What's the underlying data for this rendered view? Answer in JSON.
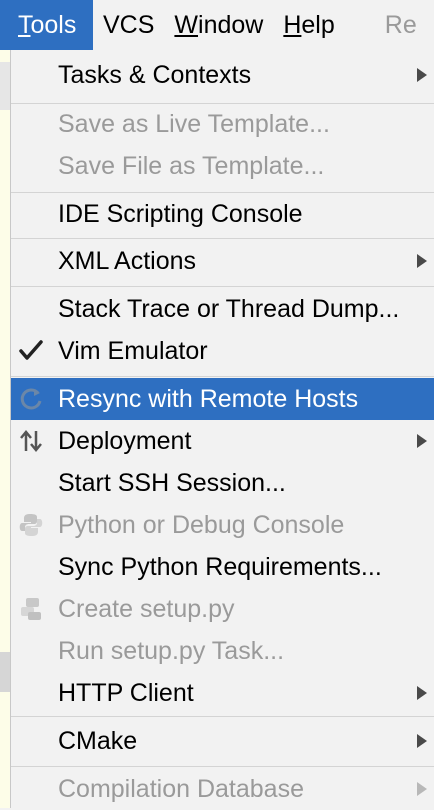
{
  "menubar": {
    "items": [
      {
        "label": "Tools",
        "active": true
      },
      {
        "label": "VCS"
      },
      {
        "label": "Window"
      },
      {
        "label": "Help"
      },
      {
        "label": "Re"
      }
    ]
  },
  "menu": {
    "tasks": "Tasks & Contexts",
    "save_live_template": "Save as Live Template...",
    "save_file_template": "Save File as Template...",
    "ide_scripting": "IDE Scripting Console",
    "xml_actions": "XML Actions",
    "stack_trace": "Stack Trace or Thread Dump...",
    "vim_emulator": "Vim Emulator",
    "resync": "Resync with Remote Hosts",
    "deployment": "Deployment",
    "ssh": "Start SSH Session...",
    "python_console": "Python or Debug Console",
    "sync_python": "Sync Python Requirements...",
    "create_setup": "Create setup.py",
    "run_setup": "Run setup.py Task...",
    "http_client": "HTTP Client",
    "cmake": "CMake",
    "compilation_db": "Compilation Database"
  },
  "colors": {
    "selection": "#2e6fc1",
    "disabled_text": "#9a9a9a",
    "menu_bg": "#f2f2f2"
  }
}
